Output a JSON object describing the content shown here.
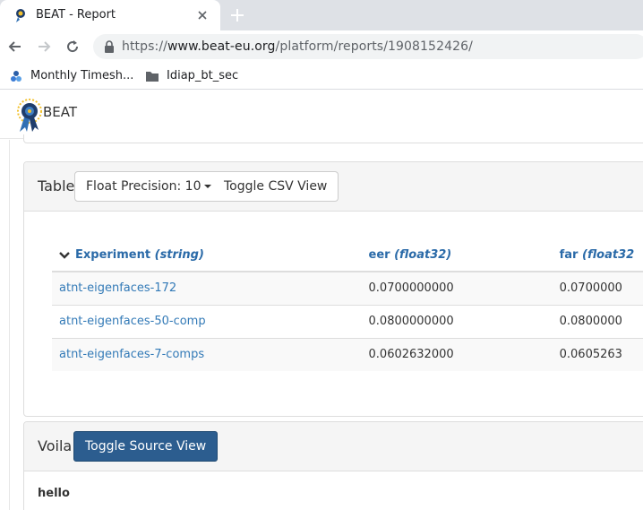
{
  "browser": {
    "tab": {
      "title": "BEAT - Report"
    },
    "address": {
      "scheme": "https://",
      "host": "www.beat-eu.org",
      "path": "/platform/reports/1908152426/"
    },
    "bookmarks": [
      {
        "label": "Monthly Timesh...",
        "icon": "app-icon"
      },
      {
        "label": "Idiap_bt_sec",
        "icon": "folder-icon"
      }
    ]
  },
  "site": {
    "brand": "BEAT"
  },
  "table_panel": {
    "title": "Table",
    "precision_button": "Float Precision: 10",
    "csv_button": "Toggle CSV View",
    "columns": [
      {
        "name": "Experiment",
        "type": "(string)"
      },
      {
        "name": "eer",
        "type": "(float32)"
      },
      {
        "name": "far",
        "type": "(float32"
      }
    ],
    "rows": [
      {
        "experiment": "atnt-eigenfaces-172",
        "eer": "0.0700000000",
        "far": "0.0700000"
      },
      {
        "experiment": "atnt-eigenfaces-50-comp",
        "eer": "0.0800000000",
        "far": "0.0800000"
      },
      {
        "experiment": "atnt-eigenfaces-7-comps",
        "eer": "0.0602632000",
        "far": "0.0605263"
      }
    ]
  },
  "voila_panel": {
    "title": "Voila",
    "source_button": "Toggle Source View",
    "body_text": "hello"
  },
  "colors": {
    "link": "#337ab7",
    "header_link": "#2a6aa8",
    "primary_button": "#2c5d8f"
  }
}
